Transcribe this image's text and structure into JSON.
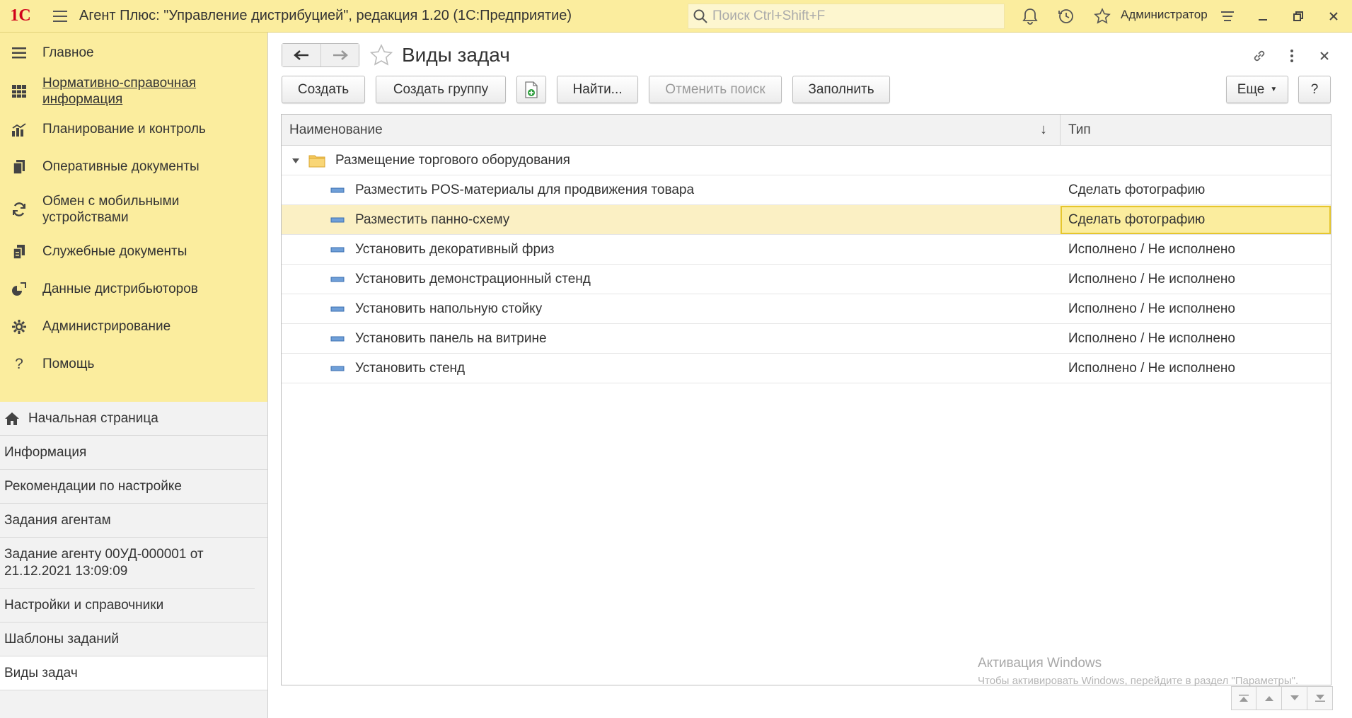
{
  "topbar": {
    "logo": "1С",
    "app_title": "Агент Плюс: \"Управление дистрибуцией\", редакция 1.20  (1С:Предприятие)",
    "search_placeholder": "Поиск Ctrl+Shift+F",
    "user": "Администратор",
    "icons": [
      "bell-icon",
      "history-icon",
      "star-icon",
      "settings-lines-icon"
    ],
    "window_buttons": [
      "minimize-icon",
      "restore-icon",
      "close-icon"
    ]
  },
  "sidebar": {
    "sections": [
      {
        "label": "Главное",
        "icon": "menu-lines-icon"
      },
      {
        "label": "Нормативно-справочная информация",
        "icon": "grid-icon",
        "link": true
      },
      {
        "label": "Планирование и контроль",
        "icon": "bar-chart-icon"
      },
      {
        "label": "Оперативные документы",
        "icon": "documents-icon"
      },
      {
        "label": "Обмен с мобильными устройствами",
        "icon": "sync-icon"
      },
      {
        "label": "Служебные документы",
        "icon": "service-documents-icon"
      },
      {
        "label": "Данные дистрибьюторов",
        "icon": "distributor-chart-icon"
      },
      {
        "label": "Администрирование",
        "icon": "gear-icon"
      },
      {
        "label": "Помощь",
        "icon": "question-icon"
      }
    ],
    "open_windows": [
      {
        "label": "Начальная страница",
        "icon": "home-icon"
      },
      {
        "label": "Информация"
      },
      {
        "label": "Рекомендации по настройке"
      },
      {
        "label": "Задания агентам"
      },
      {
        "label": "Задание агенту 00УД-000001 от 21.12.2021 13:09:09"
      },
      {
        "label": "Настройки и справочники"
      },
      {
        "label": "Шаблоны заданий"
      },
      {
        "label": "Виды задач",
        "active": true
      }
    ]
  },
  "main": {
    "title": "Виды задач",
    "toolbar": {
      "create": "Создать",
      "create_group": "Создать группу",
      "find": "Найти...",
      "cancel_search": "Отменить поиск",
      "fill": "Заполнить",
      "more": "Еще",
      "help": "?"
    },
    "table": {
      "columns": [
        "Наименование",
        "Тип"
      ],
      "sort_indicator": "↓",
      "group": "Размещение торгового оборудования",
      "rows": [
        {
          "name": "Разместить POS-материалы для продвижения товара",
          "type": "Сделать фотографию"
        },
        {
          "name": "Разместить панно-схему",
          "type": "Сделать фотографию",
          "selected": true
        },
        {
          "name": "Установить декоративный фриз",
          "type": "Исполнено / Не исполнено"
        },
        {
          "name": "Установить демонстрационный стенд",
          "type": "Исполнено / Не исполнено"
        },
        {
          "name": "Установить напольную стойку",
          "type": "Исполнено / Не исполнено"
        },
        {
          "name": "Установить панель на витрине",
          "type": "Исполнено / Не исполнено"
        },
        {
          "name": "Установить стенд",
          "type": "Исполнено / Не исполнено"
        }
      ]
    },
    "watermark": {
      "title": "Активация Windows",
      "text": "Чтобы активировать Windows, перейдите в раздел \"Параметры\"."
    }
  },
  "colors": {
    "topbar_bg": "#fbed9e",
    "selected_row": "#fbf0c4",
    "focused_cell_border": "#e6c62d",
    "logo_red": "#d0021b"
  }
}
